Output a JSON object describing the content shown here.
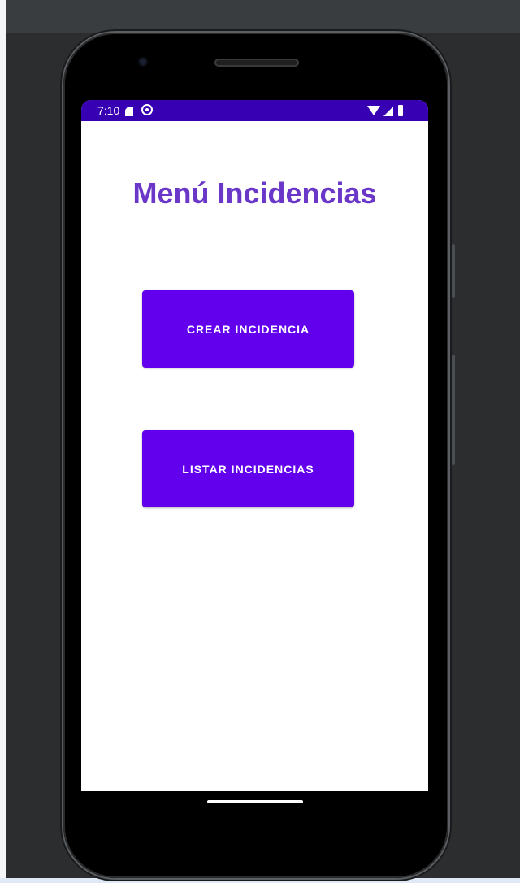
{
  "status_bar": {
    "time": "7:10"
  },
  "main": {
    "title": "Menú Incidencias",
    "buttons": {
      "crear": "CREAR INCIDENCIA",
      "listar": "LISTAR INCIDENCIAS"
    }
  },
  "colors": {
    "status_bar": "#3700b3",
    "primary_button": "#6200ee",
    "title_text": "#6a37c8",
    "screen_background": "#ffffff",
    "emulator_background": "#2b2d2f"
  },
  "icons": {
    "status_left": [
      "sd-card-icon",
      "gear-icon"
    ],
    "status_right": [
      "wifi-icon",
      "cellular-signal-icon",
      "battery-icon"
    ]
  }
}
